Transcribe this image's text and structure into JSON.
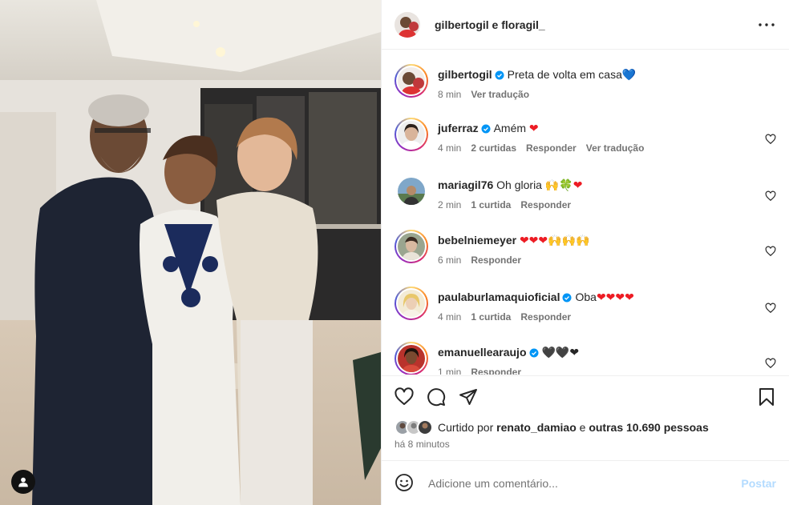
{
  "post": {
    "author_header": "gilbertogil e floragil_",
    "caption_user": "gilbertogil",
    "caption_text": "Preta de volta em casa",
    "caption_emoji": "💙",
    "caption_time": "8 min",
    "caption_translate": "Ver tradução"
  },
  "comments": [
    {
      "user": "juferraz",
      "verified": true,
      "text": "Amém",
      "emoji": "❤",
      "time": "4 min",
      "likes": "2 curtidas",
      "reply": "Responder",
      "translate": "Ver tradução",
      "story_ring": true
    },
    {
      "user": "mariagil76",
      "verified": false,
      "text": "Oh gloria",
      "emoji": "🙌🍀❤",
      "time": "2 min",
      "likes": "1 curtida",
      "reply": "Responder",
      "translate": "",
      "story_ring": false
    },
    {
      "user": "bebelniemeyer",
      "verified": false,
      "text": "",
      "emoji": "❤❤❤🙌🙌🙌",
      "time": "6 min",
      "likes": "",
      "reply": "Responder",
      "translate": "",
      "story_ring": true
    },
    {
      "user": "paulaburlamaquioficial",
      "verified": true,
      "text": "Oba",
      "emoji": "❤❤❤❤",
      "time": "4 min",
      "likes": "1 curtida",
      "reply": "Responder",
      "translate": "",
      "story_ring": true
    },
    {
      "user": "emanuellearaujo",
      "verified": true,
      "text": "",
      "emoji": "🖤🖤❤",
      "time": "1 min",
      "likes": "",
      "reply": "Responder",
      "translate": "",
      "story_ring": true
    }
  ],
  "likes": {
    "prefix": "Curtido por",
    "user": "renato_damiao",
    "connector": "e",
    "others": "outras 10.690 pessoas"
  },
  "posted_ago": "há 8 minutos",
  "add_comment": {
    "placeholder": "Adicione um comentário...",
    "post_label": "Postar"
  },
  "colors": {
    "verified": "#0095f6",
    "muted": "#737373",
    "post_disabled": "#b3dbff"
  },
  "icons": [
    "more-icon",
    "verified-icon",
    "heart-icon",
    "comment-icon",
    "share-icon",
    "bookmark-icon",
    "emoji-icon",
    "user-tag-icon"
  ]
}
